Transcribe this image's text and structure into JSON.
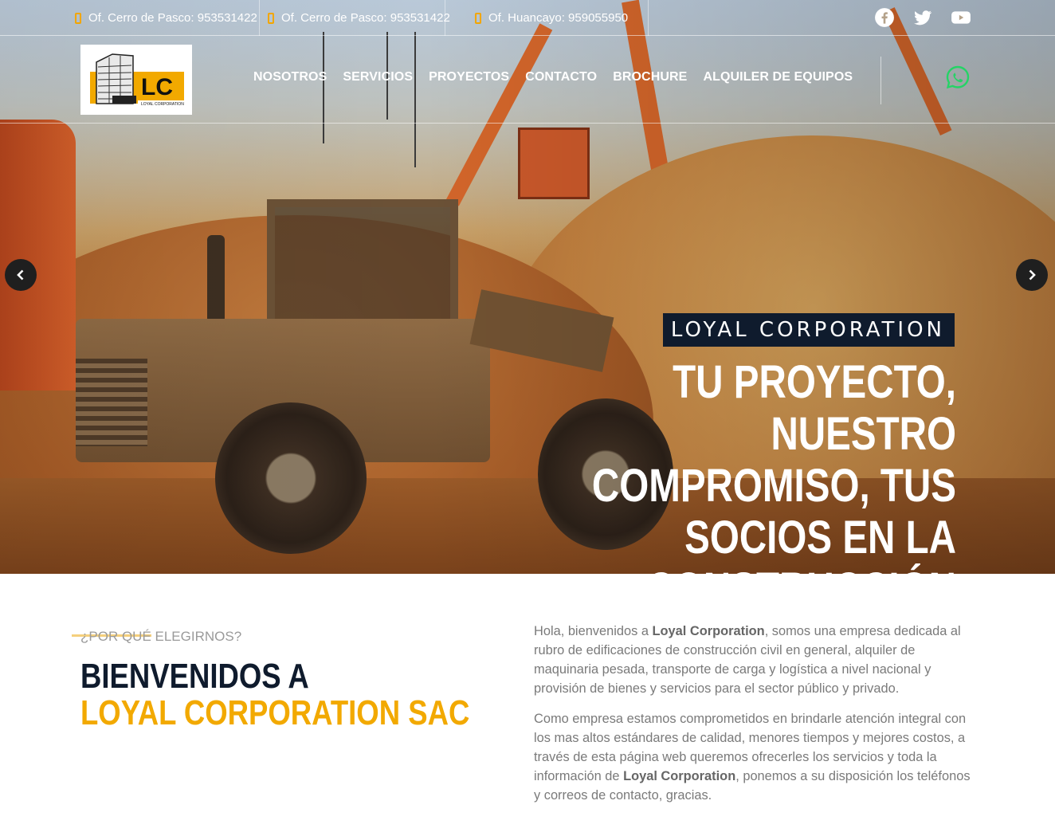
{
  "topbar": {
    "offices": [
      {
        "label": "Of. Cerro de Pasco: 953531422"
      },
      {
        "label": "Of. Cerro de Pasco: 953531422"
      },
      {
        "label": "Of. Huancayo: 959055950"
      }
    ],
    "social": [
      "facebook-icon",
      "twitter-icon",
      "youtube-icon"
    ]
  },
  "nav": {
    "logo_text": "LC",
    "logo_subtext": "LOYAL CORPORATION",
    "items": [
      "NOSOTROS",
      "SERVICIOS",
      "PROYECTOS",
      "CONTACTO",
      "BROCHURE",
      "ALQUILER DE EQUIPOS"
    ]
  },
  "hero": {
    "badge": "LOYAL CORPORATION",
    "headline_lines": [
      "TU PROYECTO, NUESTRO",
      "COMPROMISO, TUS",
      "SOCIOS EN LA",
      "CONSTRUCCIÓN"
    ]
  },
  "welcome": {
    "eyebrow": "¿POR QUÉ ELEGIRNOS?",
    "title_line1": "BIENVENIDOS A",
    "title_line2": "LOYAL CORPORATION SAC",
    "para1_a": "Hola, bienvenidos a ",
    "para1_b": "Loyal Corporation",
    "para1_c": ", somos una empresa dedicada al rubro de edificaciones de construcción civil en general, alquiler de maquinaria pesada, transporte de carga y logística a nivel nacional y provisión de bienes y servicios para el sector público y privado.",
    "para2_a": "Como empresa estamos comprometidos en brindarle atención integral con los mas altos estándares de calidad, menores tiempos y mejores costos, a través de esta página web queremos ofrecerles los servicios y toda la información de ",
    "para2_b": "Loyal Corporation",
    "para2_c": ", ponemos a su disposición los teléfonos y correos de contacto, gracias."
  },
  "colors": {
    "accent": "#f2a900",
    "navy": "#0f1b2d",
    "whatsapp": "#25d366"
  }
}
